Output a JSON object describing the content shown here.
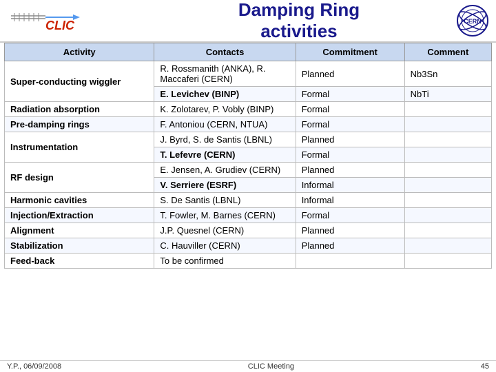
{
  "header": {
    "title_line1": "Damping Ring",
    "title_line2": "activities"
  },
  "table": {
    "columns": [
      "Activity",
      "Contacts",
      "Commitment",
      "Comment"
    ],
    "rows": [
      {
        "activity": "Super-conducting wiggler",
        "contacts": "R. Rossmanith (ANKA), R. Maccaferi (CERN)",
        "commitment": "Planned",
        "comment": "Nb3Sn",
        "rowspan": 2
      },
      {
        "activity": "",
        "contacts": "E. Levichev (BINP)",
        "commitment": "Formal",
        "comment": "NbTi"
      },
      {
        "activity": "Radiation absorption",
        "contacts": "K. Zolotarev, P. Vobly (BINP)",
        "commitment": "Formal",
        "comment": ""
      },
      {
        "activity": "Pre-damping rings",
        "contacts": "F. Antoniou (CERN, NTUA)",
        "commitment": "Formal",
        "comment": ""
      },
      {
        "activity": "Instrumentation",
        "contacts": "J. Byrd, S. de Santis (LBNL)",
        "commitment": "Planned",
        "comment": "",
        "rowspan": 2
      },
      {
        "activity": "",
        "contacts": "T. Lefevre (CERN)",
        "commitment": "Formal",
        "comment": ""
      },
      {
        "activity": "RF design",
        "contacts": "E. Jensen, A. Grudiev (CERN)",
        "commitment": "Planned",
        "comment": "",
        "rowspan": 2
      },
      {
        "activity": "",
        "contacts": "V. Serriere (ESRF)",
        "commitment": "Informal",
        "comment": ""
      },
      {
        "activity": "Harmonic cavities",
        "contacts": "S. De Santis (LBNL)",
        "commitment": "Informal",
        "comment": ""
      },
      {
        "activity": "Injection/Extraction",
        "contacts": "T. Fowler, M. Barnes (CERN)",
        "commitment": "Formal",
        "comment": ""
      },
      {
        "activity": "Alignment",
        "contacts": "J.P. Quesnel (CERN)",
        "commitment": "Planned",
        "comment": ""
      },
      {
        "activity": "Stabilization",
        "contacts": "C. Hauviller (CERN)",
        "commitment": "Planned",
        "comment": ""
      },
      {
        "activity": "Feed-back",
        "contacts": "To be confirmed",
        "commitment": "",
        "comment": ""
      }
    ]
  },
  "footer": {
    "left": "Y.P., 06/09/2008",
    "center": "CLIC Meeting",
    "right": "45"
  }
}
